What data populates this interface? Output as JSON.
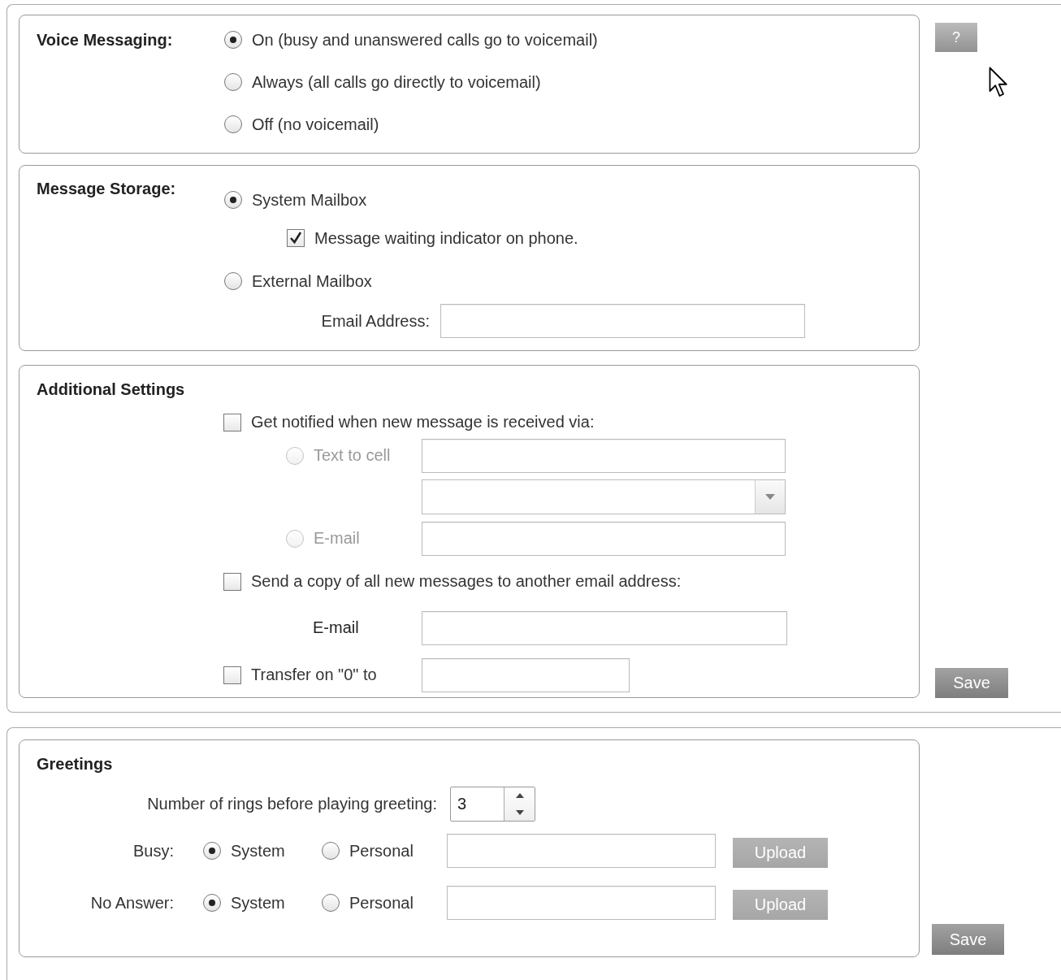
{
  "help_button": "?",
  "voice_messaging": {
    "label": "Voice Messaging:",
    "options": [
      {
        "label": "On (busy and unanswered calls go to voicemail)",
        "selected": true
      },
      {
        "label": "Always (all calls go directly to voicemail)",
        "selected": false
      },
      {
        "label": "Off (no voicemail)",
        "selected": false
      }
    ]
  },
  "message_storage": {
    "label": "Message Storage:",
    "options": [
      {
        "label": "System Mailbox",
        "selected": true
      },
      {
        "label": "External Mailbox",
        "selected": false
      }
    ],
    "indicator": {
      "label": "Message waiting indicator on phone.",
      "checked": true
    },
    "email_label": "Email Address:"
  },
  "additional_settings": {
    "title": "Additional Settings",
    "notify": {
      "label": "Get notified when new message is received via:",
      "checked": false
    },
    "notify_options": [
      {
        "label": "Text to cell",
        "selected": false,
        "disabled": true
      },
      {
        "label": "E-mail",
        "selected": false,
        "disabled": true
      }
    ],
    "copy": {
      "label": "Send a copy of all new messages to another email address:",
      "checked": false
    },
    "copy_email_label": "E-mail",
    "transfer": {
      "label": "Transfer on \"0\" to",
      "checked": false
    },
    "save_button": "Save"
  },
  "greetings": {
    "title": "Greetings",
    "rings_label": "Number of rings before playing greeting:",
    "rings_value": "3",
    "rows": [
      {
        "label": "Busy:",
        "options": [
          {
            "label": "System",
            "selected": true
          },
          {
            "label": "Personal",
            "selected": false
          }
        ],
        "upload": {
          "label": "Upload",
          "disabled": true
        }
      },
      {
        "label": "No Answer:",
        "options": [
          {
            "label": "System",
            "selected": true
          },
          {
            "label": "Personal",
            "selected": false
          }
        ],
        "upload": {
          "label": "Upload",
          "disabled": true
        }
      }
    ],
    "save_button": "Save"
  }
}
